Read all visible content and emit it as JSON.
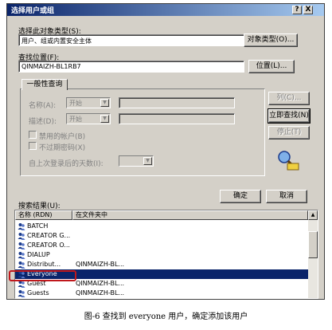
{
  "window": {
    "title": "选择用户或组",
    "help_button": "?",
    "close_button": "X"
  },
  "object_type": {
    "label": "选择此对象类型(S):",
    "value": "用户、组或内置安全主体",
    "button": "对象类型(O)..."
  },
  "location": {
    "label": "查找位置(F):",
    "value": "QINMAIZH-BL1RB7",
    "button": "位置(L)..."
  },
  "common_queries": {
    "tab_label": "一般性查询",
    "name_label": "名称(A):",
    "name_op": "开始",
    "desc_label": "描述(D):",
    "desc_op": "开始",
    "disabled_accounts": "禁用的帐户(B)",
    "no_expire_password": "不过期密码(X)",
    "days_since_logon_label": "自上次登录后的天数(I):"
  },
  "side_buttons": {
    "columns": "列(C)...",
    "find_now": "立即查找(N)",
    "stop": "停止(T)"
  },
  "dialog_buttons": {
    "ok": "确定",
    "cancel": "取消"
  },
  "search_results": {
    "label": "搜索结果(U):",
    "columns": [
      "名称 (RDN)",
      "在文件夹中"
    ],
    "rows": [
      {
        "name": "BATCH",
        "folder": "",
        "selected": false
      },
      {
        "name": "CREATOR G...",
        "folder": "",
        "selected": false
      },
      {
        "name": "CREATOR O...",
        "folder": "",
        "selected": false
      },
      {
        "name": "DIALUP",
        "folder": "",
        "selected": false
      },
      {
        "name": "Distribut...",
        "folder": "QINMAIZH-BL...",
        "selected": false
      },
      {
        "name": "Everyone",
        "folder": "",
        "selected": true
      },
      {
        "name": "Guest",
        "folder": "QINMAIZH-BL...",
        "selected": false
      },
      {
        "name": "Guests",
        "folder": "QINMAIZH-BL...",
        "selected": false
      }
    ]
  },
  "caption": "图-6 查找到 everyone 用户，确定添加该用户",
  "colors": {
    "dialog_bg": "#d4d0c8",
    "title_start": "#0a246a",
    "title_end": "#a6caf0",
    "selection": "#0a246a",
    "highlight_box": "#c0181c"
  }
}
